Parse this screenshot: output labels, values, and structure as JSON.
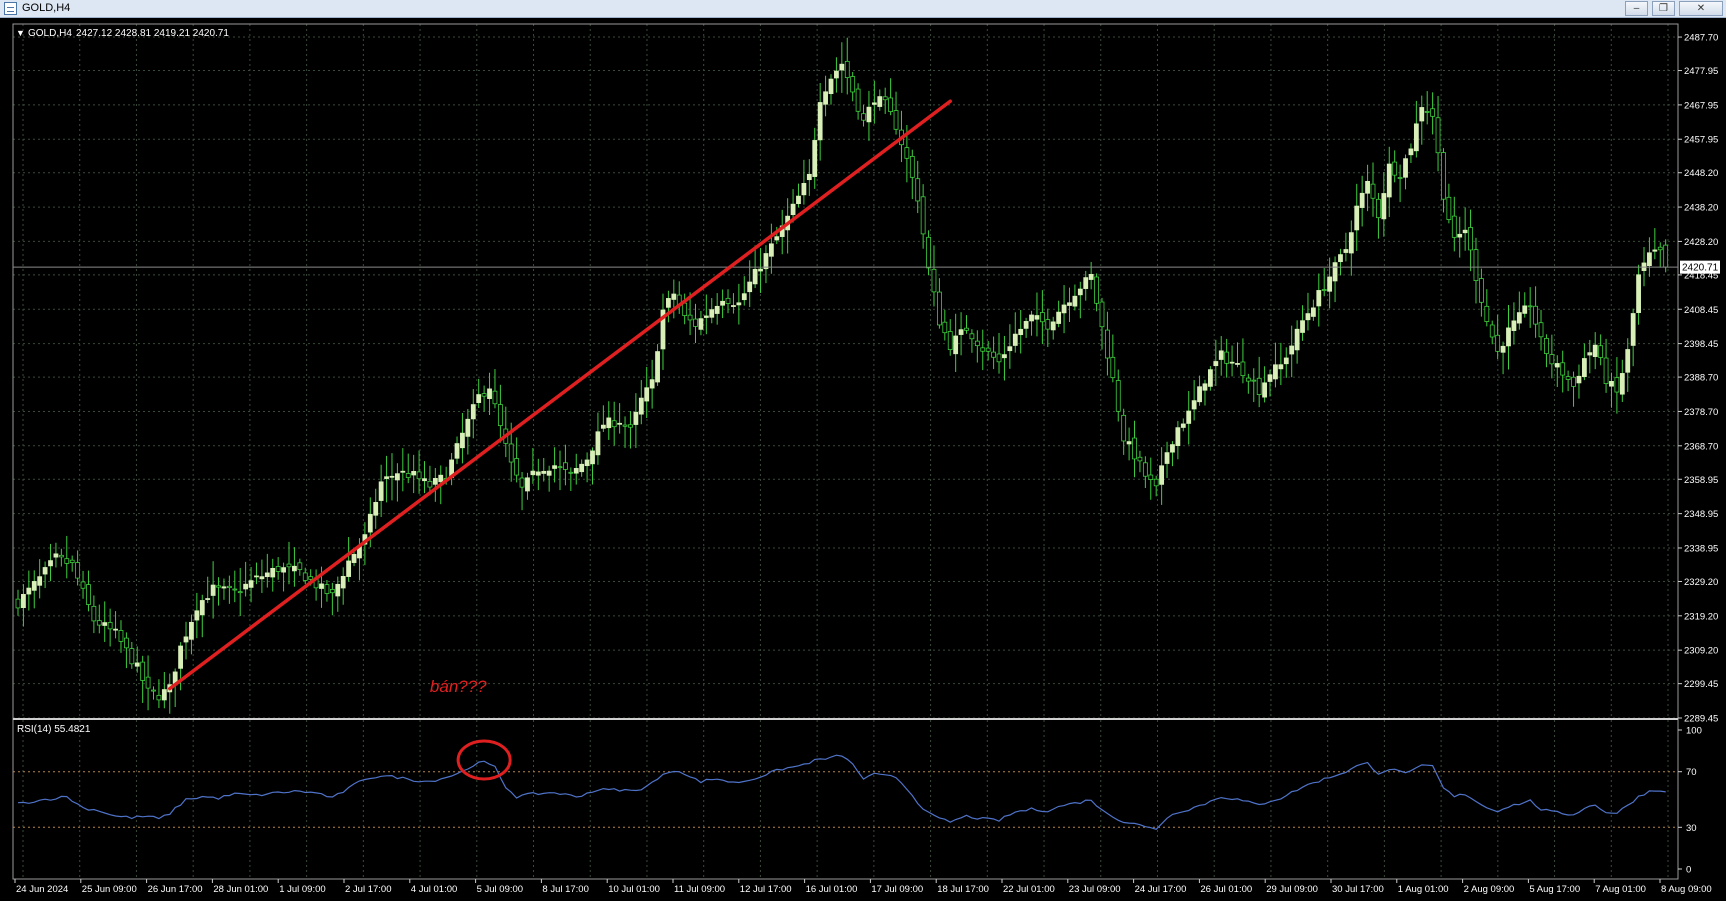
{
  "window": {
    "title": "GOLD,H4",
    "buttons": [
      "–",
      "❐",
      "✕"
    ]
  },
  "main_chart": {
    "header_arrow": "▼",
    "symbol": "GOLD,H4",
    "ohlc": "2427.12 2428.81 2419.21 2420.71",
    "current_price_label": "2420.71",
    "current_price": 2420.71,
    "price_axis_labels": [
      "2487.70",
      "2477.95",
      "2467.95",
      "2457.95",
      "2448.20",
      "2438.20",
      "2428.20",
      "2418.45",
      "2408.45",
      "2398.45",
      "2388.70",
      "2378.70",
      "2368.70",
      "2358.95",
      "2348.95",
      "2338.95",
      "2329.20",
      "2319.20",
      "2309.20",
      "2299.45",
      "2289.45"
    ],
    "annotation_text": "bán???",
    "colors": {
      "background": "#000000",
      "grid": "#3a4a3a",
      "bull": "#d8f0b8",
      "bear": "#000000",
      "wick": "#3fcf3f",
      "trendline": "#e02020",
      "annotation": "#e02020"
    }
  },
  "rsi_panel": {
    "label": "RSI(14) 55.4821",
    "axis_labels": [
      "100",
      "70",
      "30",
      "0"
    ],
    "levels": [
      70,
      30
    ],
    "colors": {
      "line": "#4f73c9",
      "level": "#b8864b",
      "circle": "#e02020"
    }
  },
  "time_axis": {
    "labels": [
      "24 Jun 2024",
      "25 Jun 09:00",
      "26 Jun 17:00",
      "28 Jun 01:00",
      "1 Jul 09:00",
      "2 Jul 17:00",
      "4 Jul 01:00",
      "5 Jul 09:00",
      "8 Jul 17:00",
      "10 Jul 01:00",
      "11 Jul 09:00",
      "12 Jul 17:00",
      "16 Jul 01:00",
      "17 Jul 09:00",
      "18 Jul 17:00",
      "22 Jul 01:00",
      "23 Jul 09:00",
      "24 Jul 17:00",
      "26 Jul 01:00",
      "29 Jul 09:00",
      "30 Jul 17:00",
      "1 Aug 01:00",
      "2 Aug 09:00",
      "5 Aug 17:00",
      "7 Aug 01:00",
      "8 Aug 09:00"
    ]
  },
  "chart_data": {
    "type": "candlestick",
    "symbol": "GOLD",
    "timeframe": "H4",
    "ylim": [
      2289.45,
      2491.5
    ],
    "rsi_ylim": [
      0,
      100
    ],
    "anchors": [
      [
        0,
        2323
      ],
      [
        4,
        2330
      ],
      [
        7,
        2336
      ],
      [
        10,
        2334
      ],
      [
        14,
        2318
      ],
      [
        18,
        2314
      ],
      [
        22,
        2304
      ],
      [
        24,
        2297
      ],
      [
        26,
        2296
      ],
      [
        28,
        2298
      ],
      [
        30,
        2310
      ],
      [
        33,
        2322
      ],
      [
        36,
        2327
      ],
      [
        40,
        2326
      ],
      [
        44,
        2330
      ],
      [
        48,
        2333
      ],
      [
        52,
        2332
      ],
      [
        56,
        2327
      ],
      [
        58,
        2325
      ],
      [
        61,
        2335
      ],
      [
        64,
        2342
      ],
      [
        67,
        2358
      ],
      [
        70,
        2361
      ],
      [
        73,
        2360
      ],
      [
        76,
        2357
      ],
      [
        79,
        2360
      ],
      [
        82,
        2372
      ],
      [
        85,
        2383
      ],
      [
        87,
        2386
      ],
      [
        89,
        2374
      ],
      [
        91,
        2363
      ],
      [
        93,
        2356
      ],
      [
        96,
        2362
      ],
      [
        99,
        2363
      ],
      [
        102,
        2360
      ],
      [
        105,
        2365
      ],
      [
        108,
        2375
      ],
      [
        111,
        2376
      ],
      [
        113,
        2373
      ],
      [
        115,
        2382
      ],
      [
        117,
        2387
      ],
      [
        119,
        2408
      ],
      [
        121,
        2413
      ],
      [
        123,
        2406
      ],
      [
        125,
        2404
      ],
      [
        127,
        2407
      ],
      [
        130,
        2412
      ],
      [
        133,
        2410
      ],
      [
        135,
        2416
      ],
      [
        138,
        2424
      ],
      [
        141,
        2432
      ],
      [
        143,
        2438
      ],
      [
        146,
        2447
      ],
      [
        148,
        2470
      ],
      [
        150,
        2476
      ],
      [
        152,
        2480
      ],
      [
        154,
        2472
      ],
      [
        156,
        2463
      ],
      [
        158,
        2470
      ],
      [
        160,
        2468
      ],
      [
        162,
        2462
      ],
      [
        164,
        2452
      ],
      [
        166,
        2441
      ],
      [
        168,
        2420
      ],
      [
        170,
        2405
      ],
      [
        172,
        2398
      ],
      [
        175,
        2403
      ],
      [
        178,
        2397
      ],
      [
        181,
        2393
      ],
      [
        184,
        2401
      ],
      [
        187,
        2406
      ],
      [
        190,
        2404
      ],
      [
        193,
        2410
      ],
      [
        196,
        2415
      ],
      [
        198,
        2418
      ],
      [
        200,
        2403
      ],
      [
        202,
        2388
      ],
      [
        204,
        2371
      ],
      [
        206,
        2366
      ],
      [
        208,
        2360
      ],
      [
        210,
        2356
      ],
      [
        212,
        2367
      ],
      [
        214,
        2374
      ],
      [
        216,
        2378
      ],
      [
        219,
        2388
      ],
      [
        222,
        2395
      ],
      [
        225,
        2392
      ],
      [
        227,
        2389
      ],
      [
        229,
        2385
      ],
      [
        231,
        2390
      ],
      [
        233,
        2392
      ],
      [
        235,
        2398
      ],
      [
        237,
        2405
      ],
      [
        239,
        2410
      ],
      [
        242,
        2418
      ],
      [
        245,
        2426
      ],
      [
        247,
        2438
      ],
      [
        249,
        2445
      ],
      [
        251,
        2436
      ],
      [
        253,
        2450
      ],
      [
        255,
        2448
      ],
      [
        257,
        2456
      ],
      [
        259,
        2468
      ],
      [
        261,
        2465
      ],
      [
        263,
        2442
      ],
      [
        265,
        2428
      ],
      [
        267,
        2432
      ],
      [
        269,
        2418
      ],
      [
        271,
        2405
      ],
      [
        273,
        2396
      ],
      [
        275,
        2402
      ],
      [
        277,
        2406
      ],
      [
        279,
        2410
      ],
      [
        281,
        2399
      ],
      [
        283,
        2393
      ],
      [
        285,
        2390
      ],
      [
        287,
        2386
      ],
      [
        289,
        2394
      ],
      [
        291,
        2398
      ],
      [
        293,
        2388
      ],
      [
        295,
        2384
      ],
      [
        297,
        2396
      ],
      [
        299,
        2418
      ],
      [
        301,
        2424
      ],
      [
        303,
        2425
      ],
      [
        304,
        2420.71
      ]
    ],
    "rsi_anchors": [
      [
        0,
        47
      ],
      [
        5,
        50
      ],
      [
        9,
        52
      ],
      [
        12,
        44
      ],
      [
        15,
        42
      ],
      [
        18,
        38
      ],
      [
        21,
        37
      ],
      [
        24,
        38
      ],
      [
        26,
        36
      ],
      [
        28,
        40
      ],
      [
        31,
        50
      ],
      [
        34,
        52
      ],
      [
        37,
        51
      ],
      [
        40,
        54
      ],
      [
        44,
        53
      ],
      [
        48,
        55
      ],
      [
        52,
        56
      ],
      [
        56,
        54
      ],
      [
        58,
        51
      ],
      [
        61,
        58
      ],
      [
        64,
        65
      ],
      [
        67,
        67
      ],
      [
        70,
        66
      ],
      [
        73,
        64
      ],
      [
        76,
        63
      ],
      [
        79,
        66
      ],
      [
        82,
        70
      ],
      [
        84,
        75
      ],
      [
        86,
        77
      ],
      [
        88,
        73
      ],
      [
        90,
        59
      ],
      [
        92,
        52
      ],
      [
        95,
        54
      ],
      [
        99,
        55
      ],
      [
        103,
        52
      ],
      [
        107,
        57
      ],
      [
        111,
        57
      ],
      [
        114,
        56
      ],
      [
        117,
        62
      ],
      [
        120,
        70
      ],
      [
        122,
        71
      ],
      [
        124,
        66
      ],
      [
        126,
        63
      ],
      [
        129,
        65
      ],
      [
        132,
        62
      ],
      [
        135,
        64
      ],
      [
        138,
        68
      ],
      [
        141,
        72
      ],
      [
        144,
        74
      ],
      [
        147,
        78
      ],
      [
        150,
        80
      ],
      [
        152,
        82
      ],
      [
        154,
        75
      ],
      [
        156,
        65
      ],
      [
        158,
        68
      ],
      [
        160,
        67
      ],
      [
        162,
        66
      ],
      [
        164,
        58
      ],
      [
        166,
        48
      ],
      [
        168,
        40
      ],
      [
        170,
        36
      ],
      [
        172,
        34
      ],
      [
        175,
        38
      ],
      [
        178,
        36
      ],
      [
        181,
        35
      ],
      [
        184,
        41
      ],
      [
        187,
        43
      ],
      [
        190,
        42
      ],
      [
        193,
        46
      ],
      [
        196,
        48
      ],
      [
        198,
        50
      ],
      [
        200,
        42
      ],
      [
        202,
        38
      ],
      [
        204,
        34
      ],
      [
        206,
        33
      ],
      [
        208,
        30
      ],
      [
        210,
        29
      ],
      [
        212,
        37
      ],
      [
        214,
        41
      ],
      [
        216,
        43
      ],
      [
        219,
        47
      ],
      [
        222,
        52
      ],
      [
        225,
        50
      ],
      [
        227,
        48
      ],
      [
        229,
        46
      ],
      [
        231,
        49
      ],
      [
        233,
        51
      ],
      [
        235,
        55
      ],
      [
        237,
        59
      ],
      [
        239,
        62
      ],
      [
        242,
        66
      ],
      [
        245,
        70
      ],
      [
        247,
        74
      ],
      [
        249,
        76
      ],
      [
        251,
        69
      ],
      [
        253,
        72
      ],
      [
        255,
        70
      ],
      [
        257,
        70
      ],
      [
        259,
        74
      ],
      [
        261,
        74
      ],
      [
        263,
        58
      ],
      [
        265,
        52
      ],
      [
        267,
        54
      ],
      [
        269,
        49
      ],
      [
        271,
        44
      ],
      [
        273,
        42
      ],
      [
        275,
        45
      ],
      [
        277,
        47
      ],
      [
        279,
        49
      ],
      [
        281,
        43
      ],
      [
        283,
        41
      ],
      [
        285,
        40
      ],
      [
        287,
        39
      ],
      [
        289,
        44
      ],
      [
        291,
        46
      ],
      [
        293,
        41
      ],
      [
        295,
        40
      ],
      [
        297,
        46
      ],
      [
        299,
        52
      ],
      [
        301,
        56
      ],
      [
        303,
        57
      ],
      [
        304,
        55.48
      ]
    ],
    "trendline": {
      "from": [
        28,
        2298
      ],
      "to": [
        172,
        2469
      ]
    },
    "rsi_circle_at": [
      86,
      77
    ]
  }
}
